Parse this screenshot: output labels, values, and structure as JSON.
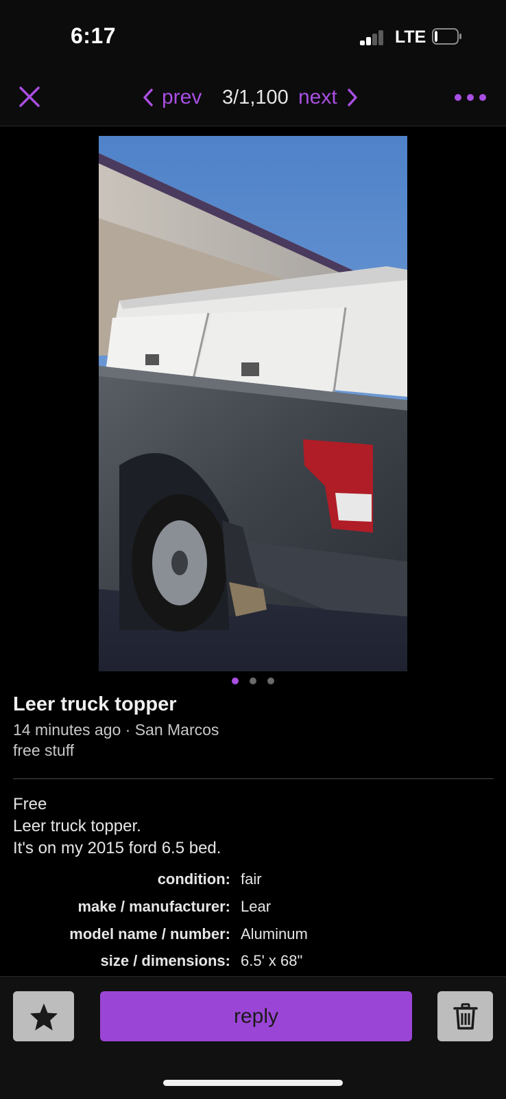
{
  "status_bar": {
    "time": "6:17",
    "network": "LTE",
    "signal_bars_active": 2,
    "signal_bars_total": 4,
    "battery_level": 0.1
  },
  "nav": {
    "close_icon": "close-icon",
    "prev_label": "prev",
    "counter": "3/1,100",
    "next_label": "next",
    "more_icon": "more-horizontal-icon"
  },
  "photo": {
    "dots_total": 3,
    "dots_active_index": 0
  },
  "listing": {
    "title": "Leer truck topper",
    "meta": "14 minutes ago · San Marcos",
    "category": "free stuff",
    "description": [
      "Free",
      "Leer truck topper.",
      "It's on my 2015 ford 6.5 bed."
    ],
    "attributes": [
      {
        "key": "condition:",
        "value": "fair"
      },
      {
        "key": "make / manufacturer:",
        "value": "Lear"
      },
      {
        "key": "model name / number:",
        "value": "Aluminum"
      },
      {
        "key": "size / dimensions:",
        "value": "6.5' x 68\""
      }
    ]
  },
  "actions": {
    "favorite_icon": "star-icon",
    "reply_label": "reply",
    "delete_icon": "trash-icon"
  },
  "colors": {
    "accent": "#a94fe2",
    "reply_button": "#9b45d6",
    "background": "#000000",
    "secondary_button": "#bdbdbd",
    "dot_inactive": "#6a6a6a"
  }
}
